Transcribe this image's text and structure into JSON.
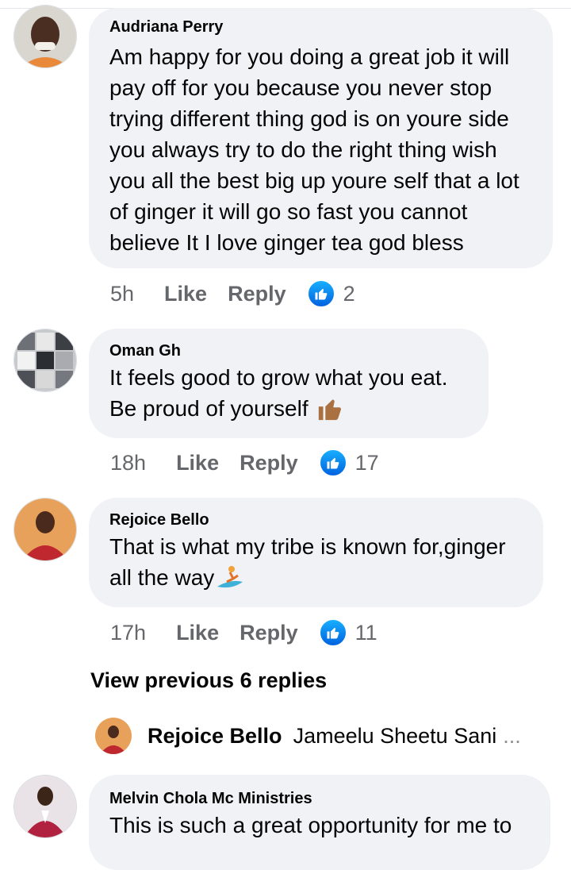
{
  "comments": [
    {
      "author": "Audriana Perry",
      "lines": [
        "Am happy for you doing a great job it will",
        "pay off for you because you  never stop",
        "trying different thing god is on youre side",
        "you always try to do the right thing wish",
        "you all the best big up youre self that a lot",
        "of ginger it will go so fast you cannot",
        "believe It I love ginger tea god bless"
      ],
      "time": "5h",
      "like_label": "Like",
      "reply_label": "Reply",
      "reaction_count": "2"
    },
    {
      "author": "Oman Gh",
      "lines": [
        "It feels good to grow what you eat.",
        "Be proud of yourself"
      ],
      "time": "18h",
      "like_label": "Like",
      "reply_label": "Reply",
      "reaction_count": "17"
    },
    {
      "author": "Rejoice Bello",
      "lines": [
        "That is what my tribe is known for,ginger",
        "all the way"
      ],
      "time": "17h",
      "like_label": "Like",
      "reply_label": "Reply",
      "reaction_count": "11"
    },
    {
      "author": "Melvin Chola Mc Ministries",
      "lines": [
        "This is such a great opportunity for me to"
      ]
    }
  ],
  "view_previous": "View previous 6 replies",
  "reply_preview": {
    "author": "Rejoice Bello",
    "text": "Jameelu Sheetu Sani",
    "ellipsis": "..."
  },
  "colors": {
    "bubble": "#f0f2f5",
    "secondary_text": "#65676b",
    "like_blue": "#1877f2"
  }
}
